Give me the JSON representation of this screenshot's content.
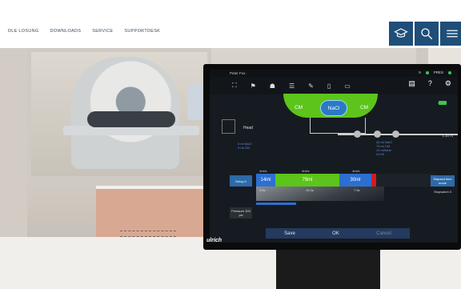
{
  "nav": {
    "items": [
      "DLE LOSUNG",
      "DOWNLOADS",
      "SERVICE",
      "SUPPORTDESK"
    ]
  },
  "header_buttons": [
    {
      "name": "academy",
      "icon": "graduation-cap-icon"
    },
    {
      "name": "search",
      "icon": "search-icon"
    },
    {
      "name": "menu",
      "icon": "hamburger-menu-icon"
    }
  ],
  "colors": {
    "brand": "#1f4e79",
    "green": "#5cc41a",
    "blue": "#2d6fd1",
    "red": "#d11c1c"
  },
  "injector_ui": {
    "title": "Peter Fox",
    "status": {
      "count": "5",
      "pres_label": "PRES"
    },
    "chamber_labels": [
      "CM",
      "NaCl",
      "CM"
    ],
    "patient_area": "Head",
    "info_left": [
      "5 ml NaCl",
      "5 ml CM"
    ],
    "info_mid": [
      "45 ml NaCl",
      "75 ml CM",
      "10 ml/total",
      "20:29"
    ],
    "info_right": "1:30 m",
    "rates": [
      "4ml/s",
      "4ml/s",
      "4ml/s"
    ],
    "flow": [
      "14ml",
      "79ml",
      "30ml"
    ],
    "delay_btn": "Delay\n0",
    "right_btn1": "Elapsed time\nmode",
    "right_btn2": "Stopwatch\n0",
    "volumes": [
      "3.5s",
      "15.3s",
      "7.5s"
    ],
    "pressure_btn": "Pressure\n300 psi",
    "buttons": {
      "save": "Save",
      "ok": "OK",
      "cancel": "Cancel"
    },
    "logo": "ulrich"
  },
  "caption": "~~~~~~~~~"
}
